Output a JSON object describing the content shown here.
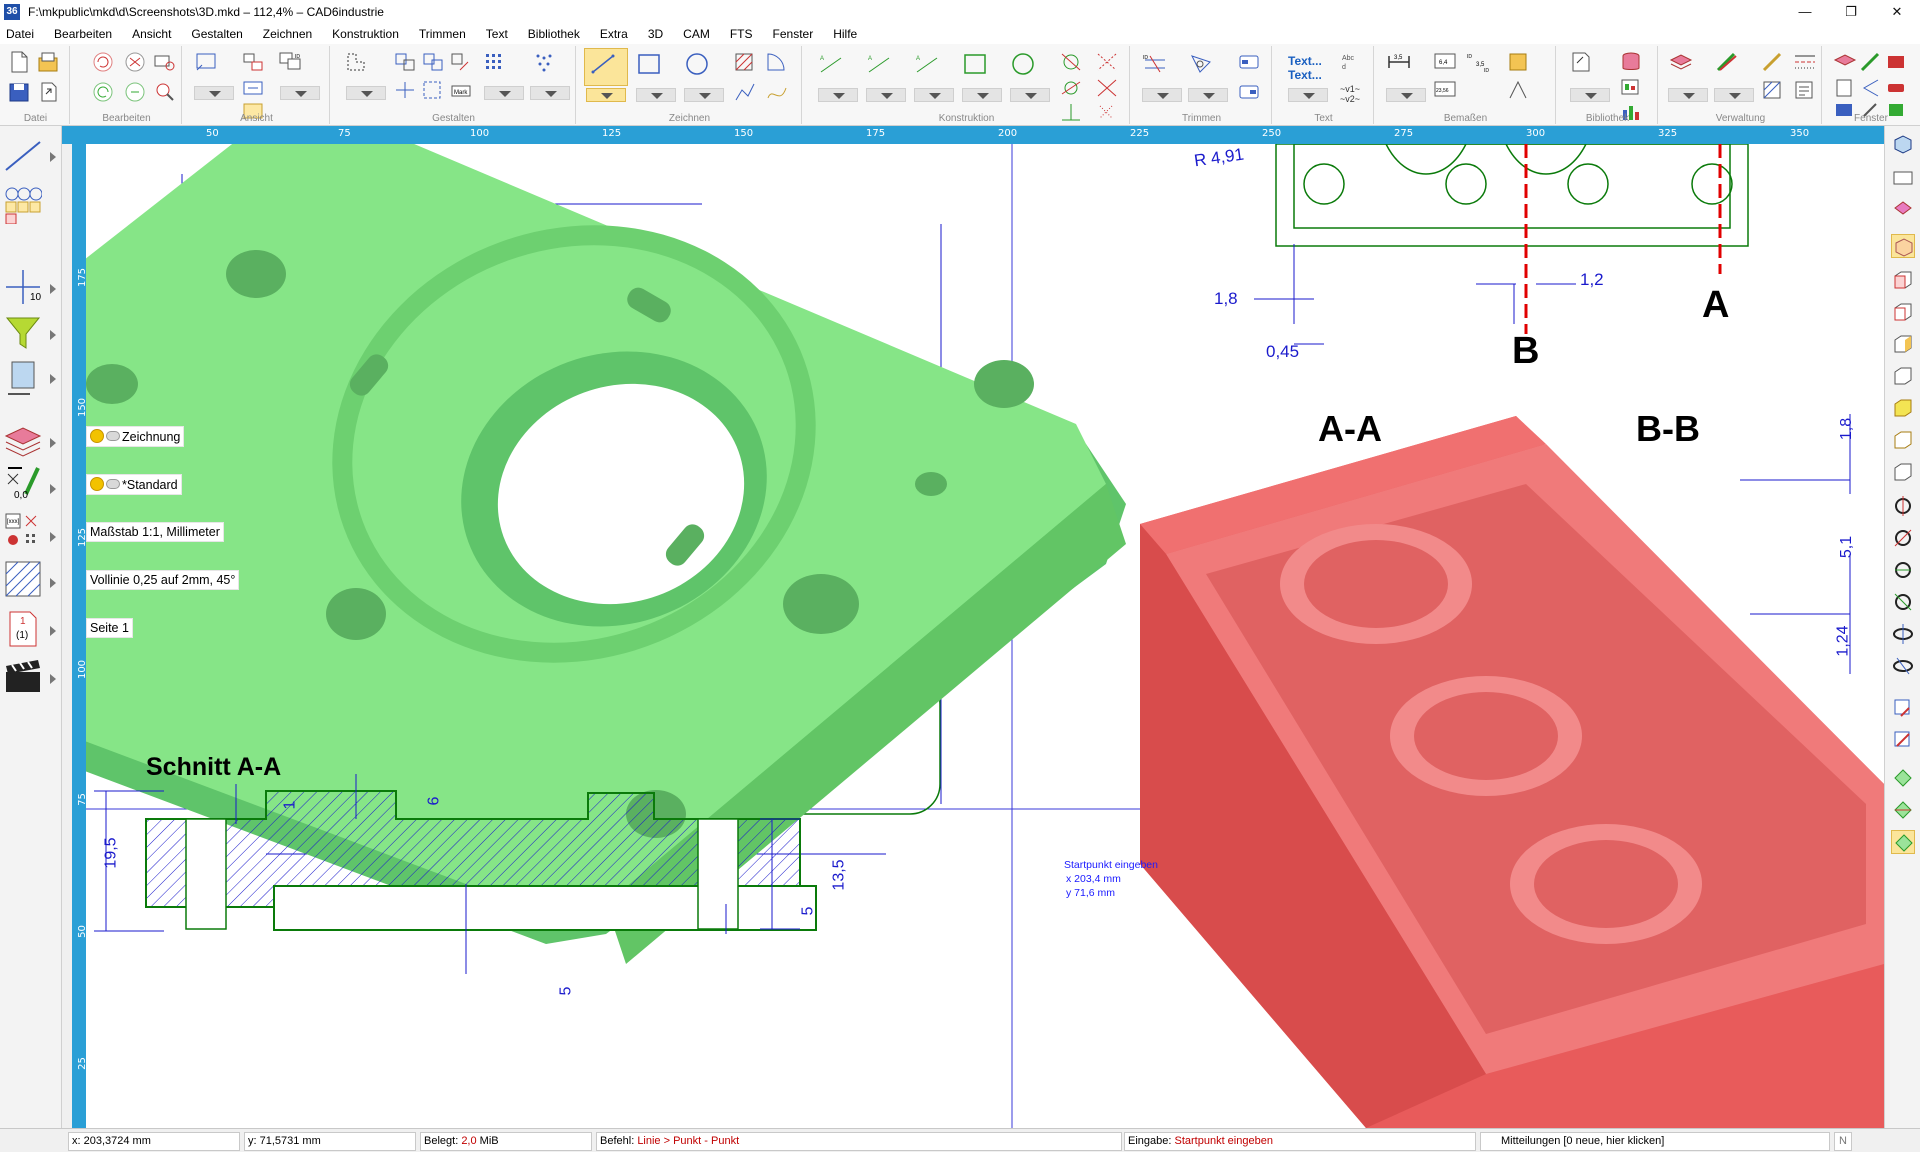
{
  "window": {
    "icon_text": "36",
    "title": "F:\\mkpublic\\mkd\\d\\Screenshots\\3D.mkd – 112,4% – CAD6industrie",
    "buttons": [
      "—",
      "❐",
      "✕"
    ]
  },
  "menu": [
    "Datei",
    "Bearbeiten",
    "Ansicht",
    "Gestalten",
    "Zeichnen",
    "Konstruktion",
    "Trimmen",
    "Text",
    "Bibliothek",
    "Extra",
    "3D",
    "CAM",
    "FTS",
    "Fenster",
    "Hilfe"
  ],
  "ribbon": {
    "groups": [
      "Datei",
      "Bearbeiten",
      "Ansicht",
      "Gestalten",
      "Zeichnen",
      "Konstruktion",
      "Trimmen",
      "Text",
      "Bemaßen",
      "Bibliothek",
      "Verwaltung",
      "Fenster"
    ],
    "text_tool_lines": [
      "Text...",
      "Text..."
    ],
    "dim_values": [
      "3,5",
      "3,5",
      "ID",
      "3,5",
      "ID"
    ],
    "dropdown_values": [
      "~v1~",
      "~v2~"
    ]
  },
  "hruler_labels": [
    "50",
    "75",
    "100",
    "125",
    "150",
    "175",
    "200",
    "225",
    "250",
    "275",
    "300",
    "325",
    "350"
  ],
  "vruler_labels": [
    "175",
    "150",
    "125",
    "100",
    "75",
    "50",
    "25"
  ],
  "left_tools": {
    "counter": "10",
    "angle_value": "0,0",
    "page_marker": "1",
    "page_sub": "(1)"
  },
  "layers": [
    {
      "label": "Zeichnung"
    },
    {
      "label": "*Standard"
    },
    {
      "label": "Maßstab 1:1, Millimeter"
    },
    {
      "label": "Vollinie 0,25 auf 2mm, 45°"
    },
    {
      "label": "Seite 1"
    }
  ],
  "drawing": {
    "section_title_left": "Schnitt A-A",
    "section_title_aa": "A-A",
    "section_title_bb": "B-B",
    "cut_labels": [
      "A",
      "B"
    ],
    "dims_top": [
      "R 4,91",
      "1,8",
      "0,45",
      "1,2"
    ],
    "dims_right": [
      "1,8",
      "5,1",
      "1,24"
    ],
    "dims_section": [
      "19,5",
      "6",
      "1",
      "13,5",
      "5",
      "5"
    ],
    "hint_lines": [
      "Startpunkt eingeben",
      "x  203,4 mm",
      "y  71,6 mm"
    ],
    "colors": {
      "green_part": "#86e587",
      "red_part": "#e85b5b",
      "line_green": "#0a7a0a",
      "dim_blue": "#1a1acc",
      "cut_red": "#e00000"
    }
  },
  "statusbar": {
    "x": "x: 203,3724 mm",
    "y": "y: 71,5731 mm",
    "mem_label": "Belegt: ",
    "mem_value": "2,0",
    "mem_unit": " MiB",
    "cmd_label": "Befehl: ",
    "cmd_value": "Linie > Punkt - Punkt",
    "input_label": "Eingabe: ",
    "input_value": "Startpunkt eingeben",
    "messages": "Mitteilungen [0 neue, hier klicken]",
    "nbtn": "N"
  }
}
